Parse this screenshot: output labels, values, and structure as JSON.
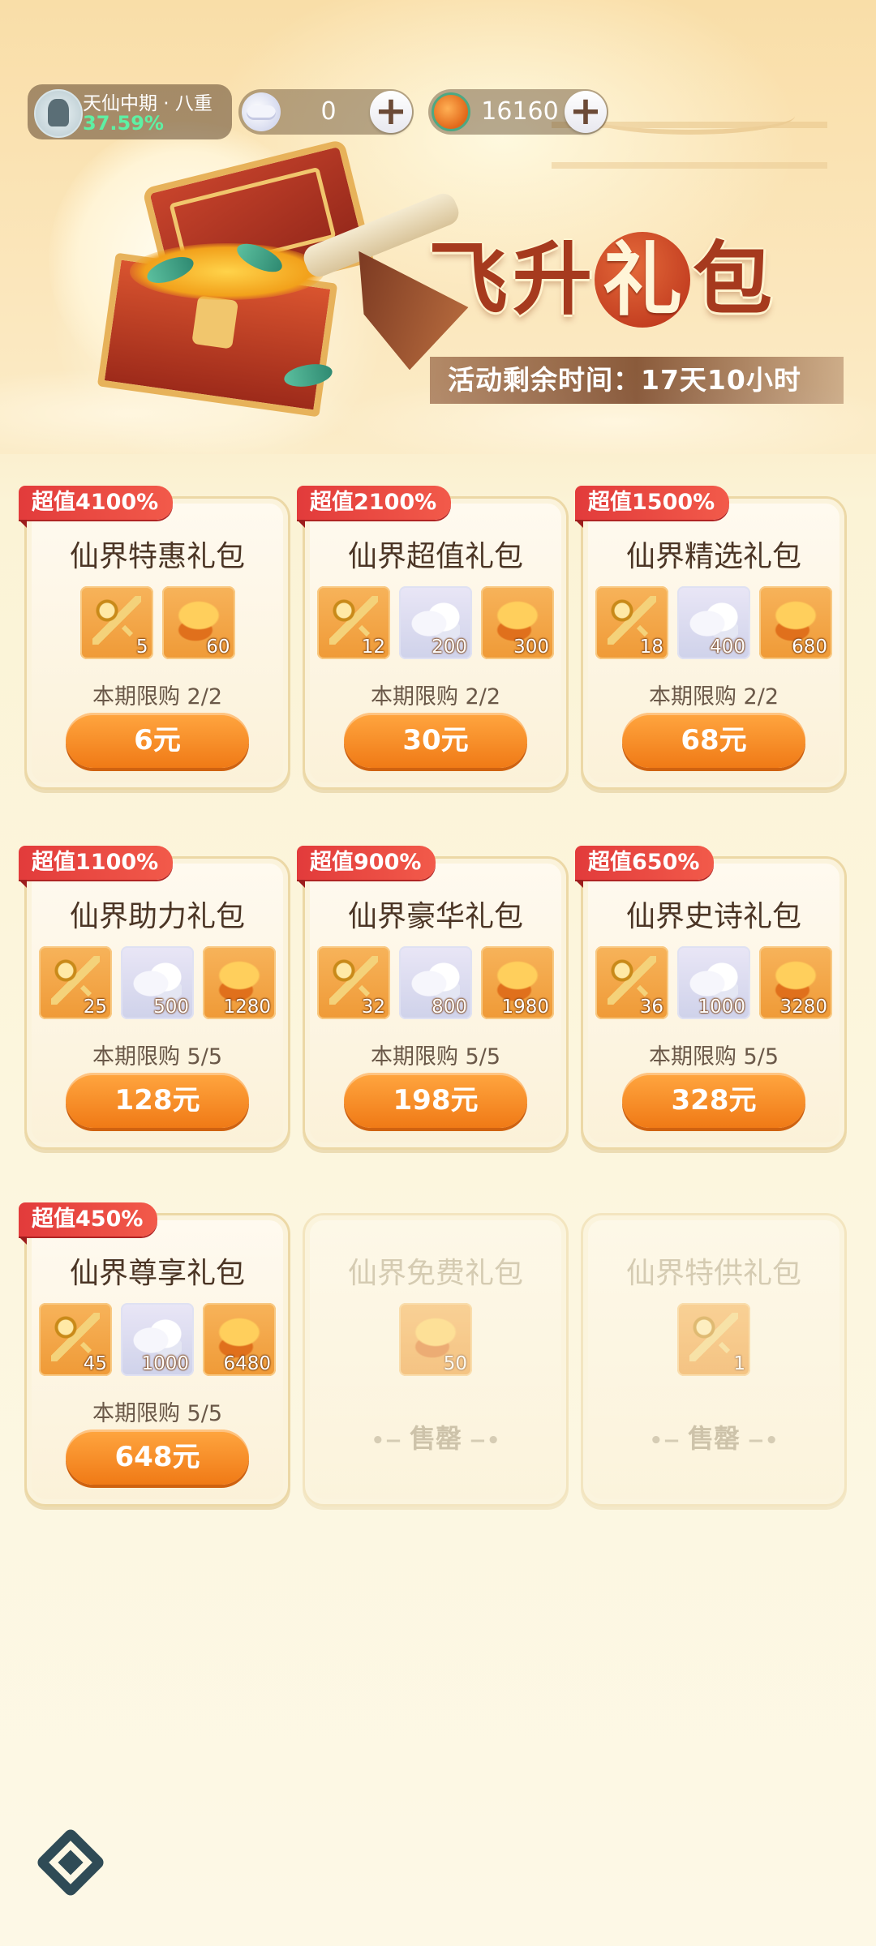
{
  "header": {
    "rank": "天仙中期 · 八重",
    "progress": "37.59%",
    "currency1": {
      "icon": "cloud-icon",
      "value": "0",
      "add": "+"
    },
    "currency2": {
      "icon": "jade-coin-icon",
      "value": "16160",
      "add": "+"
    }
  },
  "banner": {
    "title_chars": [
      "飞",
      "升",
      "礼",
      "包"
    ],
    "timer": "活动剩余时间：17天10小时"
  },
  "packs": [
    {
      "badge": "超值4100%",
      "name": "仙界特惠礼包",
      "items": [
        {
          "icon": "key-icon",
          "qty": "5"
        },
        {
          "icon": "jade-icon",
          "qty": "60"
        }
      ],
      "limit": "本期限购 2/2",
      "price": "6元"
    },
    {
      "badge": "超值2100%",
      "name": "仙界超值礼包",
      "items": [
        {
          "icon": "key-icon",
          "qty": "12"
        },
        {
          "icon": "cloud-icon",
          "qty": "200"
        },
        {
          "icon": "jade-icon",
          "qty": "300"
        }
      ],
      "limit": "本期限购 2/2",
      "price": "30元"
    },
    {
      "badge": "超值1500%",
      "name": "仙界精选礼包",
      "items": [
        {
          "icon": "key-icon",
          "qty": "18"
        },
        {
          "icon": "cloud-icon",
          "qty": "400"
        },
        {
          "icon": "jade-icon",
          "qty": "680"
        }
      ],
      "limit": "本期限购 2/2",
      "price": "68元"
    },
    {
      "badge": "超值1100%",
      "name": "仙界助力礼包",
      "items": [
        {
          "icon": "key-icon",
          "qty": "25"
        },
        {
          "icon": "cloud-icon",
          "qty": "500"
        },
        {
          "icon": "jade-icon",
          "qty": "1280"
        }
      ],
      "limit": "本期限购 5/5",
      "price": "128元"
    },
    {
      "badge": "超值900%",
      "name": "仙界豪华礼包",
      "items": [
        {
          "icon": "key-icon",
          "qty": "32"
        },
        {
          "icon": "cloud-icon",
          "qty": "800"
        },
        {
          "icon": "jade-icon",
          "qty": "1980"
        }
      ],
      "limit": "本期限购 5/5",
      "price": "198元"
    },
    {
      "badge": "超值650%",
      "name": "仙界史诗礼包",
      "items": [
        {
          "icon": "key-icon",
          "qty": "36"
        },
        {
          "icon": "cloud-icon",
          "qty": "1000"
        },
        {
          "icon": "jade-icon",
          "qty": "3280"
        }
      ],
      "limit": "本期限购 5/5",
      "price": "328元"
    },
    {
      "badge": "超值450%",
      "name": "仙界尊享礼包",
      "items": [
        {
          "icon": "key-icon",
          "qty": "45"
        },
        {
          "icon": "cloud-icon",
          "qty": "1000"
        },
        {
          "icon": "jade-icon",
          "qty": "6480"
        }
      ],
      "limit": "本期限购 5/5",
      "price": "648元"
    },
    {
      "badge": "",
      "name": "仙界免费礼包",
      "items": [
        {
          "icon": "jade-icon",
          "qty": "50"
        }
      ],
      "limit": "",
      "price": "",
      "soldout": "售罄"
    },
    {
      "badge": "",
      "name": "仙界特供礼包",
      "items": [
        {
          "icon": "key-icon",
          "qty": "1"
        }
      ],
      "limit": "",
      "price": "",
      "soldout": "售罄"
    }
  ],
  "colors": {
    "accent": "#f07a16",
    "badge": "#e23b3b",
    "title": "#a63a1e"
  }
}
